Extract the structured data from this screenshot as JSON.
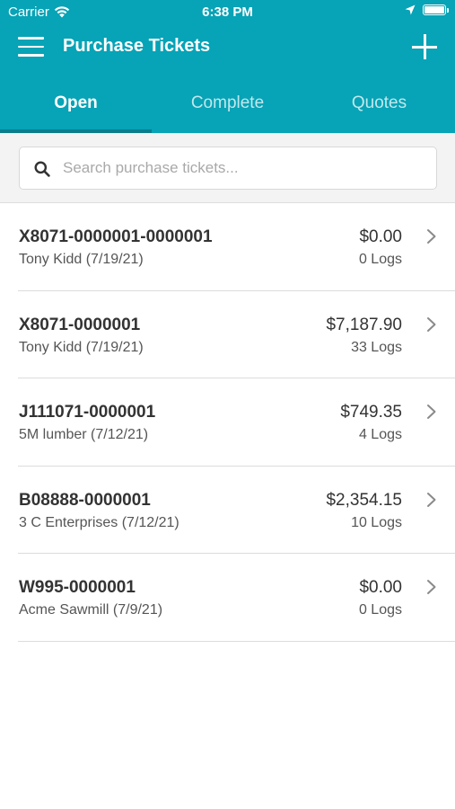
{
  "status_bar": {
    "carrier": "Carrier",
    "time": "6:38 PM"
  },
  "nav": {
    "title": "Purchase Tickets"
  },
  "tabs": [
    {
      "label": "Open",
      "active": true
    },
    {
      "label": "Complete",
      "active": false
    },
    {
      "label": "Quotes",
      "active": false
    }
  ],
  "search": {
    "placeholder": "Search purchase tickets...",
    "value": ""
  },
  "tickets": [
    {
      "id": "X8071-0000001-0000001",
      "subtitle": "Tony Kidd (7/19/21)",
      "amount": "$0.00",
      "logs": "0 Logs"
    },
    {
      "id": "X8071-0000001",
      "subtitle": "Tony Kidd (7/19/21)",
      "amount": "$7,187.90",
      "logs": "33 Logs"
    },
    {
      "id": "J111071-0000001",
      "subtitle": "5M lumber (7/12/21)",
      "amount": "$749.35",
      "logs": "4 Logs"
    },
    {
      "id": "B08888-0000001",
      "subtitle": "3 C Enterprises (7/12/21)",
      "amount": "$2,354.15",
      "logs": "10 Logs"
    },
    {
      "id": "W995-0000001",
      "subtitle": "Acme Sawmill (7/9/21)",
      "amount": "$0.00",
      "logs": "0 Logs"
    }
  ],
  "colors": {
    "header": "#07A3B6",
    "tab_indicator": "#0a7d8d"
  },
  "icons": {
    "menu": "hamburger-menu-icon",
    "add": "plus-icon",
    "search": "search-icon",
    "row": "chevron-right-icon",
    "wifi": "wifi-icon",
    "location": "location-arrow-icon",
    "battery": "battery-icon"
  }
}
